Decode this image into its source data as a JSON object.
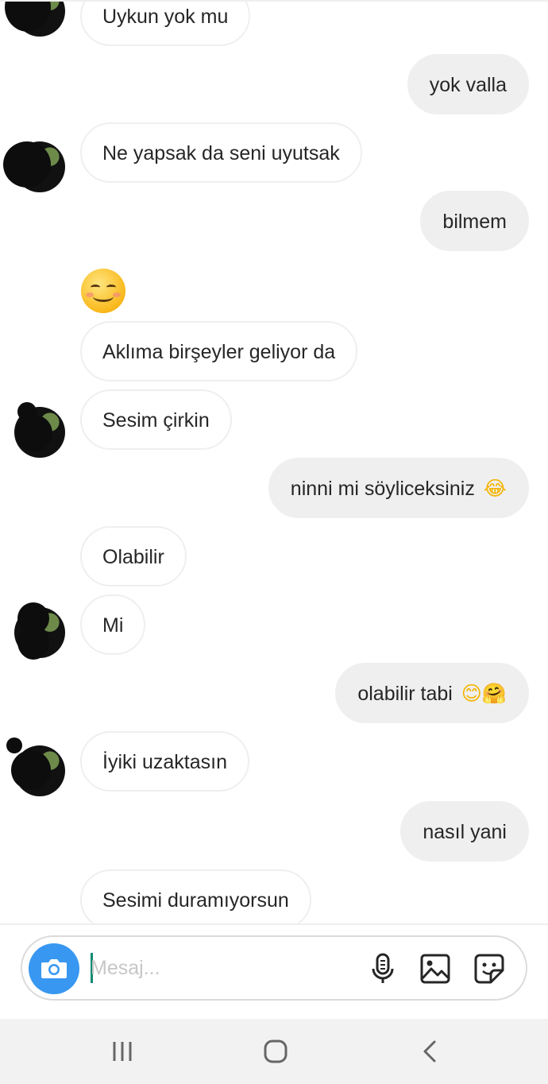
{
  "messages": [
    {
      "side": "in",
      "text": "Uykun yok mu",
      "avatar": true
    },
    {
      "side": "out",
      "text": "yok valla"
    },
    {
      "side": "in",
      "text": "Ne yapsak da seni uyutsak",
      "avatar": true
    },
    {
      "side": "out",
      "text": "bilmem"
    },
    {
      "side": "in",
      "emoji_only": "smiling-face-emoji"
    },
    {
      "side": "in",
      "text": "Aklıma birşeyler geliyor da"
    },
    {
      "side": "in",
      "text": "Sesim çirkin",
      "avatar": true
    },
    {
      "side": "out",
      "text": "ninni mi söyliceksiniz",
      "emoji": "😂"
    },
    {
      "side": "in",
      "text": "Olabilir"
    },
    {
      "side": "in",
      "text": "Mi",
      "avatar": true
    },
    {
      "side": "out",
      "text": "olabilir tabi",
      "emoji": "😊🤗"
    },
    {
      "side": "in",
      "text": "İyiki uzaktasın",
      "avatar": true
    },
    {
      "side": "out",
      "text": "nasıl yani"
    },
    {
      "side": "in",
      "text": "Sesimi duramıyorsun"
    }
  ],
  "composer": {
    "placeholder": "Mesaj...",
    "value": "",
    "icons": [
      "camera-icon",
      "microphone-icon",
      "gallery-icon",
      "sticker-icon"
    ]
  },
  "navbar": {
    "icons": [
      "recent-apps-icon",
      "home-icon",
      "back-icon"
    ]
  },
  "colors": {
    "accent": "#3897f0",
    "incoming_border": "#efefef",
    "outgoing_bg": "#efefef",
    "text": "#262626",
    "placeholder": "#c7c7c7"
  }
}
